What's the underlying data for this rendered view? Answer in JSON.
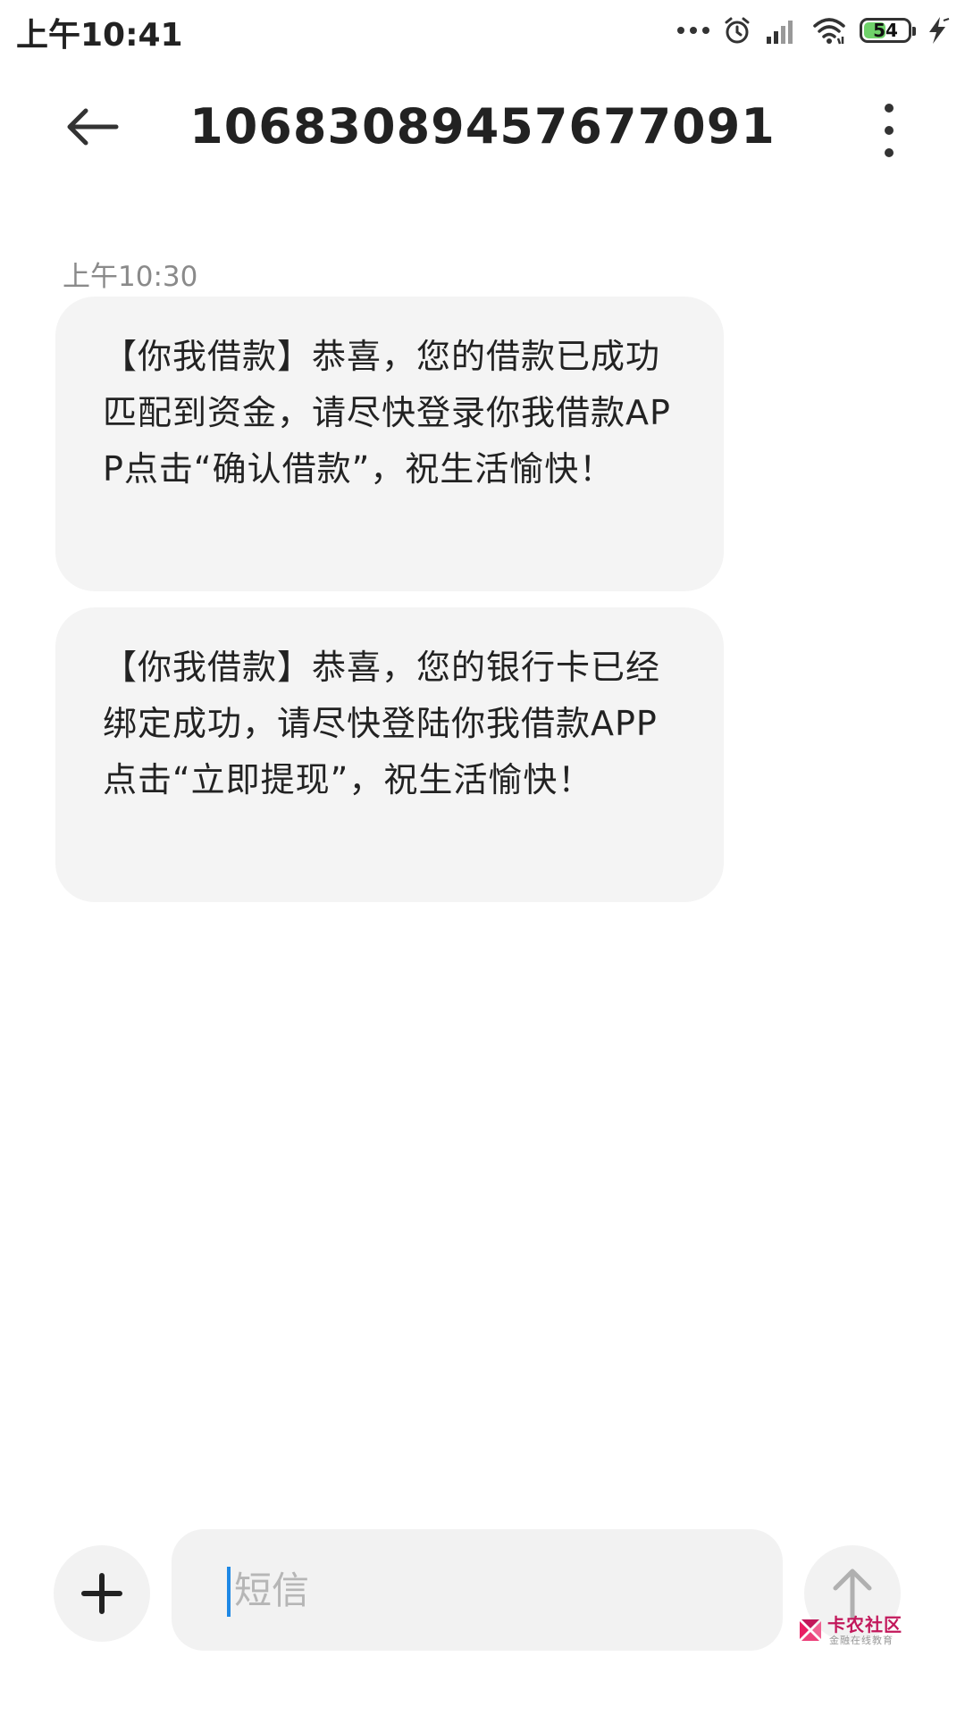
{
  "status_bar": {
    "time": "上午10:41",
    "battery_level": "54",
    "battery_percent": 54,
    "icons": [
      "more-dots-icon",
      "alarm-icon",
      "signal-icon",
      "wifi-icon",
      "battery-icon",
      "charging-bolt-icon"
    ]
  },
  "header": {
    "title": "1068308945767709 1",
    "back_icon": "arrow-left-icon",
    "more_icon": "more-vertical-icon"
  },
  "conversation": {
    "timestamp": "上午10:30",
    "messages": [
      {
        "text": "【你我借款】恭喜，您的借款已成功匹配到资金，请尽快登录你我借款APP点击“确认借款”，祝生活愉快！"
      },
      {
        "text": "【你我借款】恭喜，您的银行卡已经绑定成功，请尽快登陆你我借款APP点击“立即提现”，祝生活愉快！"
      }
    ]
  },
  "composer": {
    "add_icon": "plus-icon",
    "placeholder": "短信",
    "value": "",
    "send_icon": "arrow-up-icon"
  },
  "watermark": {
    "title": "卡农社区",
    "subtitle": "金融在线教育"
  },
  "colors": {
    "bubble_bg": "#f4f4f4",
    "cursor": "#1e88e5",
    "battery_fill": "#6fd26a",
    "watermark": "#c2185b"
  }
}
